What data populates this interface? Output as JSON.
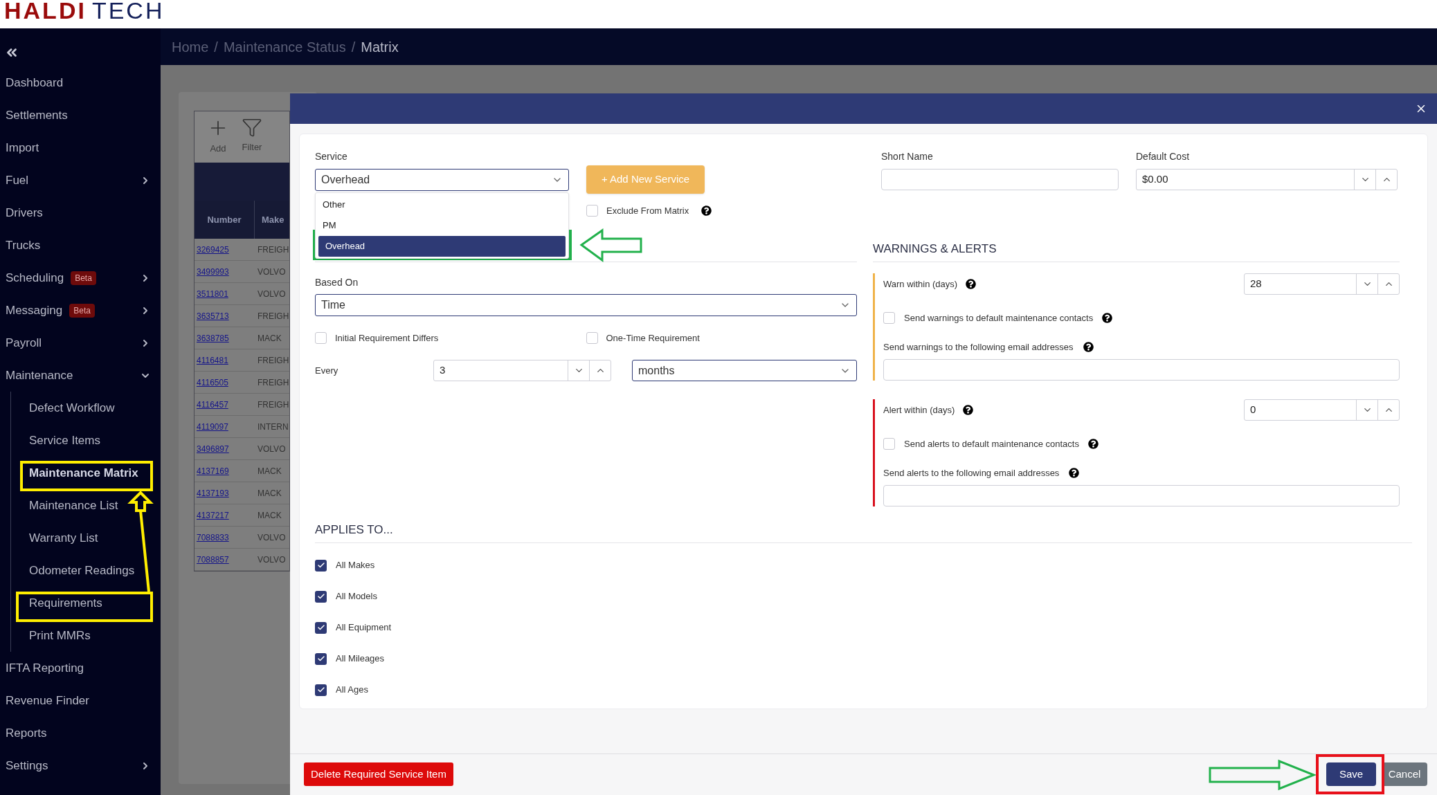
{
  "logo": {
    "part_1": "HALDI",
    "part_2": "TECH"
  },
  "breadcrumbs": {
    "separator": "/",
    "items": [
      {
        "label": "Home",
        "current": false
      },
      {
        "label": "Maintenance Status",
        "current": false
      },
      {
        "label": "Matrix",
        "current": true
      }
    ]
  },
  "sidebar": {
    "items": [
      {
        "label": "Dashboard",
        "selected": false
      },
      {
        "label": "Settlements",
        "selected": false
      },
      {
        "label": "Import",
        "selected": false
      },
      {
        "label": "Fuel",
        "selected": false,
        "expanded": false
      },
      {
        "label": "Drivers",
        "selected": false
      },
      {
        "label": "Trucks",
        "selected": false
      },
      {
        "label": "Scheduling",
        "badge": "Beta",
        "selected": false,
        "expanded": false
      },
      {
        "label": "Messaging",
        "badge": "Beta",
        "selected": false,
        "expanded": false
      },
      {
        "label": "Payroll",
        "selected": false,
        "expanded": false
      },
      {
        "label": "Maintenance",
        "selected": false,
        "expanded": true,
        "children": [
          {
            "label": "Defect Workflow",
            "selected": false
          },
          {
            "label": "Service Items",
            "selected": false
          },
          {
            "label": "Maintenance Matrix",
            "selected": true
          },
          {
            "label": "Maintenance List",
            "selected": false
          },
          {
            "label": "Warranty List",
            "selected": false
          },
          {
            "label": "Odometer Readings",
            "selected": false
          },
          {
            "label": "Requirements",
            "selected": false
          },
          {
            "label": "Print MMRs",
            "selected": false
          }
        ]
      },
      {
        "label": "IFTA Reporting",
        "selected": false
      },
      {
        "label": "Revenue Finder",
        "selected": false
      },
      {
        "label": "Reports",
        "selected": false
      },
      {
        "label": "Settings",
        "selected": false,
        "expanded": false
      }
    ]
  },
  "table": {
    "toolbar": [
      {
        "label": "Add",
        "kind": "add"
      },
      {
        "label": "Filter",
        "kind": "filter"
      }
    ],
    "columns": [
      "Number",
      "Make"
    ],
    "rows": [
      [
        "3269425",
        "FREIGH"
      ],
      [
        "3499993",
        "VOLVO"
      ],
      [
        "3511801",
        "VOLVO"
      ],
      [
        "3635713",
        "FREIGH"
      ],
      [
        "3638785",
        "MACK"
      ],
      [
        "4116481",
        "FREIGH"
      ],
      [
        "4116505",
        "FREIGH"
      ],
      [
        "4116457",
        "FREIGH"
      ],
      [
        "4119097",
        "INTERN"
      ],
      [
        "3496897",
        "VOLVO"
      ],
      [
        "4137169",
        "MACK"
      ],
      [
        "4137193",
        "MACK"
      ],
      [
        "4137217",
        "MACK"
      ],
      [
        "7088833",
        "VOLVO"
      ],
      [
        "7088857",
        "VOLVO"
      ]
    ]
  },
  "modal": {
    "service": {
      "label": "Service",
      "value": "Overhead",
      "options": [
        {
          "label": "Other",
          "selected": false
        },
        {
          "label": "PM",
          "selected": false
        },
        {
          "label": "Overhead",
          "selected": true
        }
      ]
    },
    "add_service_button": "+ Add New Service",
    "exclude_from_matrix": {
      "label": "Exclude From Matrix",
      "checked": false
    },
    "based_on": {
      "label": "Based On",
      "value": "Time"
    },
    "options": [
      {
        "label": "Initial Requirement Differs",
        "checked": false
      },
      {
        "label": "One-Time Requirement",
        "checked": false
      }
    ],
    "every": {
      "label": "Every",
      "value": "3",
      "unit": "months"
    },
    "short_name": {
      "label": "Short Name"
    },
    "default_cost": {
      "label": "Default Cost",
      "value": "$0.00"
    },
    "warnings": {
      "title": "WARNINGS & ALERTS",
      "sections": [
        {
          "kind": "warning",
          "within_label": "Warn within (days)",
          "within_value": "28",
          "contacts": {
            "label": "Send warnings to default maintenance contacts",
            "checked": false
          },
          "email_label": "Send warnings to the following email addresses"
        },
        {
          "kind": "alert",
          "within_label": "Alert within (days)",
          "within_value": "0",
          "contacts": {
            "label": "Send alerts to default maintenance contacts",
            "checked": false
          },
          "email_label": "Send alerts to the following email addresses"
        }
      ]
    },
    "applies_to": {
      "title": "APPLIES TO...",
      "items": [
        {
          "label": "All Makes",
          "checked": true
        },
        {
          "label": "All Models",
          "checked": true
        },
        {
          "label": "All Equipment",
          "checked": true
        },
        {
          "label": "All Mileages",
          "checked": true
        },
        {
          "label": "All Ages",
          "checked": true
        }
      ]
    },
    "footer": {
      "delete_button": "Delete Required Service Item",
      "save_button": "Save",
      "cancel_button": "Cancel"
    }
  }
}
